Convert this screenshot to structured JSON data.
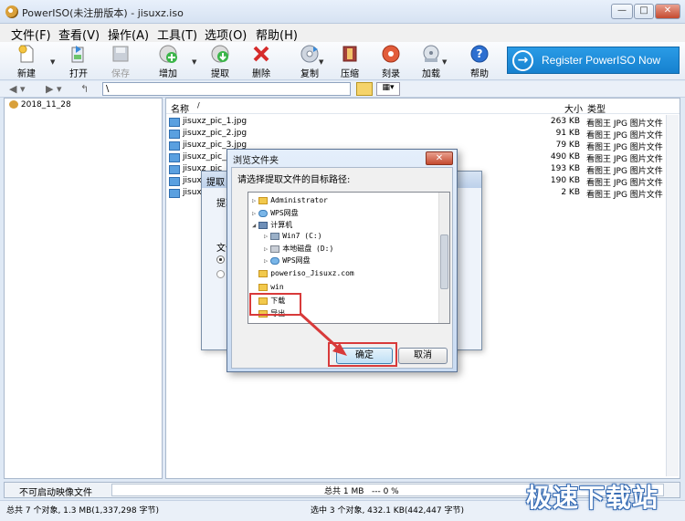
{
  "window": {
    "title": "PowerISO(未注册版本) - jisuxz.iso",
    "min": "—",
    "max": "□",
    "close": "✕"
  },
  "menu": [
    "文件(F)",
    "查看(V)",
    "操作(A)",
    "工具(T)",
    "选项(O)",
    "帮助(H)"
  ],
  "toolbar": {
    "new": "新建",
    "open": "打开",
    "save": "保存",
    "add": "增加",
    "extract": "提取",
    "delete": "删除",
    "copy": "复制",
    "compress": "压缩",
    "burn": "刻录",
    "mount": "加载",
    "help": "帮助",
    "register": "Register PowerISO Now"
  },
  "address": {
    "path": "\\"
  },
  "tree": {
    "root": "2018_11_28"
  },
  "filelist": {
    "headers": {
      "name": "名称",
      "size": "大小",
      "type": "类型"
    },
    "rows": [
      {
        "name": "jisuxz_pic_1.jpg",
        "size": "263 KB",
        "type": "看图王 JPG 图片文件"
      },
      {
        "name": "jisuxz_pic_2.jpg",
        "size": "91 KB",
        "type": "看图王 JPG 图片文件"
      },
      {
        "name": "jisuxz_pic_3.jpg",
        "size": "79 KB",
        "type": "看图王 JPG 图片文件"
      },
      {
        "name": "jisuxz_pic_4.jpg",
        "size": "490 KB",
        "type": "看图王 JPG 图片文件"
      },
      {
        "name": "jisuxz_pic_5.jpg",
        "size": "193 KB",
        "type": "看图王 JPG 图片文件"
      },
      {
        "name": "jisuxz_pic_6.jpg",
        "size": "190 KB",
        "type": "看图王 JPG 图片文件"
      },
      {
        "name": "jisuxz_pic_7.jpg",
        "size": "2 KB",
        "type": "看图王 JPG 图片文件"
      }
    ]
  },
  "extract_dialog": {
    "title": "提取",
    "label1": "提取",
    "label2": "文件"
  },
  "browse_dialog": {
    "title": "浏览文件夹",
    "prompt": "请选择提取文件的目标路径:",
    "nodes": [
      "Administrator",
      "WPS网盘",
      "计算机",
      "Win7 (C:)",
      "本地磁盘 (D:)",
      "WPS网盘",
      "poweriso_Jisuxz.com",
      "win",
      "下载",
      "导出"
    ],
    "ok": "确定",
    "cancel": "取消"
  },
  "bottombar": {
    "boot": "不可启动映像文件",
    "total": "总共 1 MB   --- 0 %"
  },
  "status": {
    "left": "总共 7 个对象, 1.3 MB(1,337,298 字节)",
    "right": "选中 3 个对象, 432.1 KB(442,447 字节)"
  },
  "watermark": "极速下载站"
}
